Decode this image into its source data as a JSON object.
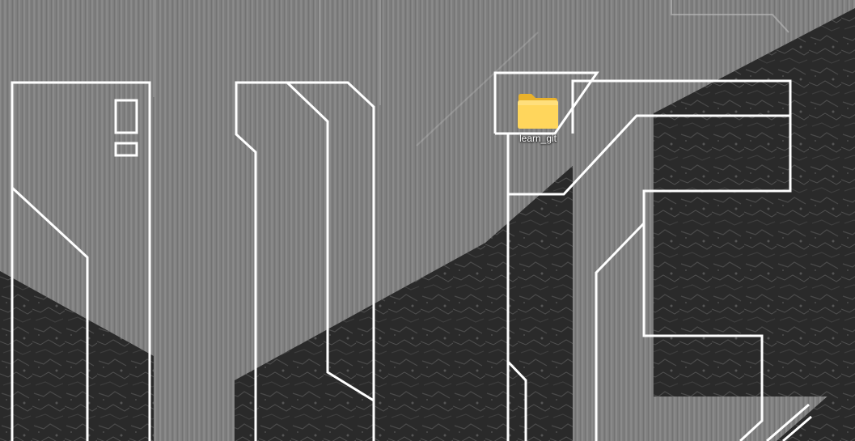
{
  "desktop": {
    "icons": [
      {
        "label": "learn_git",
        "icon": "folder-icon"
      }
    ]
  },
  "colors": {
    "wallpaper_metal": "#7e7e7e",
    "wallpaper_stone": "#2c2c2c",
    "wallpaper_lines": "#ffffff",
    "folder_front": "#ffd65c",
    "folder_back": "#e9b22c"
  }
}
